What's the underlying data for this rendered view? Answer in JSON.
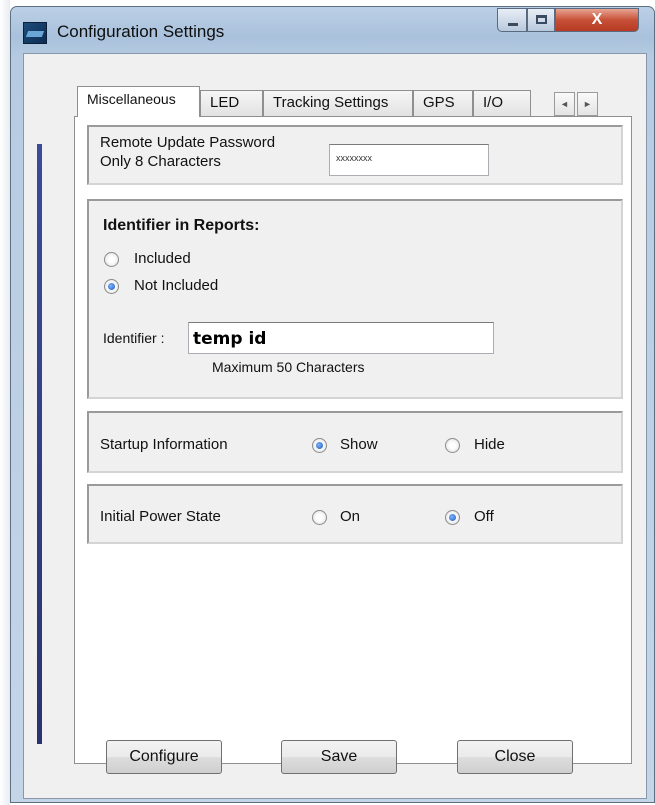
{
  "window": {
    "title": "Configuration Settings",
    "close_label": "X"
  },
  "tabs": [
    {
      "label": "Miscellaneous",
      "active": true
    },
    {
      "label": "LED",
      "active": false
    },
    {
      "label": "Tracking Settings",
      "active": false
    },
    {
      "label": "GPS",
      "active": false
    },
    {
      "label": "I/O",
      "active": false
    }
  ],
  "tab_scroll": {
    "left": "◄",
    "right": "►"
  },
  "password": {
    "label_line1": "Remote Update Password",
    "label_line2": "Only 8 Characters",
    "value": "xxxxxxxx"
  },
  "identifier_group": {
    "heading": "Identifier in Reports:",
    "options": [
      {
        "label": "Included",
        "checked": false
      },
      {
        "label": "Not Included",
        "checked": true
      }
    ],
    "field_label": "Identifier :",
    "field_value": "temp id",
    "hint": "Maximum 50 Characters"
  },
  "startup": {
    "label": "Startup Information",
    "options": [
      {
        "label": "Show",
        "checked": true
      },
      {
        "label": "Hide",
        "checked": false
      }
    ]
  },
  "power": {
    "label": "Initial Power State",
    "options": [
      {
        "label": "On",
        "checked": false
      },
      {
        "label": "Off",
        "checked": true
      }
    ]
  },
  "buttons": {
    "configure": "Configure",
    "save": "Save",
    "close": "Close"
  }
}
